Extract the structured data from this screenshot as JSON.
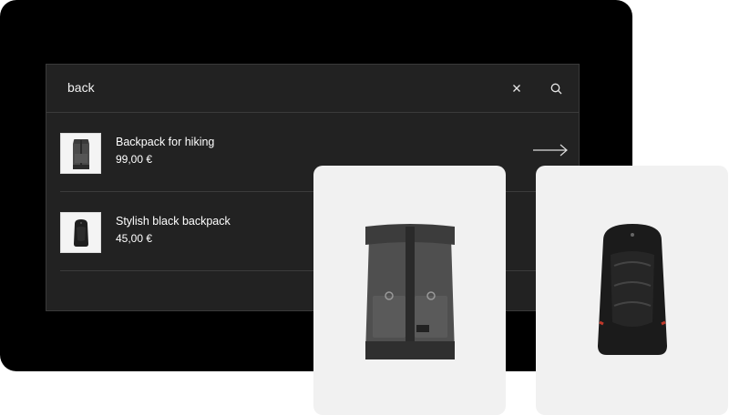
{
  "search": {
    "query": "back"
  },
  "icons": {
    "clear": "close-icon",
    "search": "search-icon",
    "arrow": "arrow-right-icon"
  },
  "results": [
    {
      "name": "Backpack for hiking",
      "price": "99,00 €"
    },
    {
      "name": "Stylish black backpack",
      "price": "45,00 €"
    }
  ],
  "colors": {
    "device_bg": "#000000",
    "panel_bg": "#222222",
    "card_bg": "#f1f1f1"
  }
}
